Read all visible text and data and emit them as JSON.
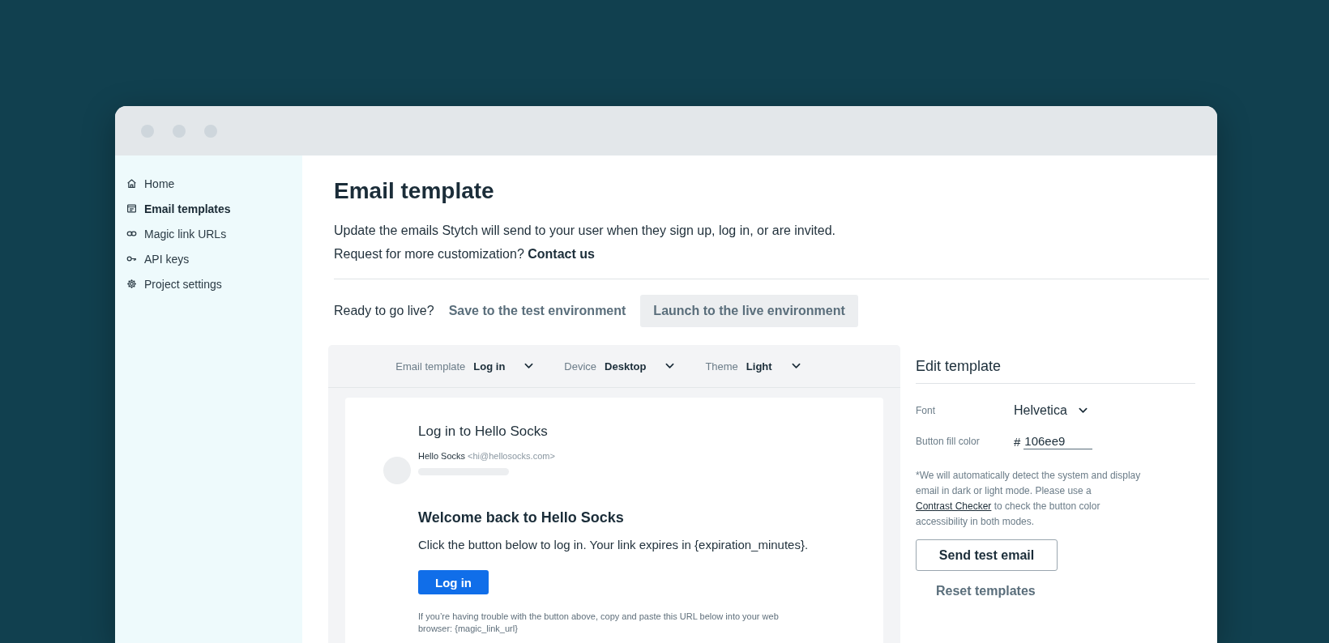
{
  "sidebar": {
    "items": [
      {
        "label": "Home",
        "kind": "home",
        "selected": false
      },
      {
        "label": "Email templates",
        "kind": "template",
        "selected": true
      },
      {
        "label": "Magic link URLs",
        "kind": "link",
        "selected": false
      },
      {
        "label": "API keys",
        "kind": "key",
        "selected": false
      },
      {
        "label": "Project settings",
        "kind": "gear",
        "selected": false
      }
    ]
  },
  "page": {
    "title": "Email template",
    "description": "Update the emails Stytch will send to your user when they sign up, log in, or are invited.",
    "request_text": "Request for more customization?",
    "contact_link": "Contact us"
  },
  "publish": {
    "prompt": "Ready to go live?",
    "buttons": [
      {
        "label": "Save to the test environment",
        "kind": "text"
      },
      {
        "label": "Launch to the live environment",
        "kind": "filled"
      }
    ]
  },
  "preview": {
    "selectors": [
      {
        "label": "Email template",
        "value": "Log in"
      },
      {
        "label": "Device",
        "value": "Desktop"
      },
      {
        "label": "Theme",
        "value": "Light"
      }
    ],
    "email": {
      "subject": "Log in to Hello Socks",
      "sender_name": "Hello Socks",
      "sender_address": "<hi@hellosocks.com>",
      "heading": "Welcome back to Hello Socks",
      "body": "Click the button below to log in. Your link expires in {expiration_minutes}.",
      "button": "Log in",
      "footer": "If you’re having trouble with the button above, copy and paste this URL below into your web browser: {magic_link_url}"
    }
  },
  "editor": {
    "title": "Edit template",
    "font_label": "Font",
    "font_value": "Helvetica",
    "color_label": "Button fill color",
    "color_prefix": "#",
    "color_value": "106ee9",
    "note_before": "*We will automatically detect the system and display email in dark or light mode. Please use a",
    "note_link": "Contrast Checker",
    "note_after": "to check the button color accessibility in both modes.",
    "buttons": [
      {
        "label": "Send test email",
        "kind": "outlined"
      },
      {
        "label": "Reset templates",
        "kind": "text"
      }
    ]
  }
}
